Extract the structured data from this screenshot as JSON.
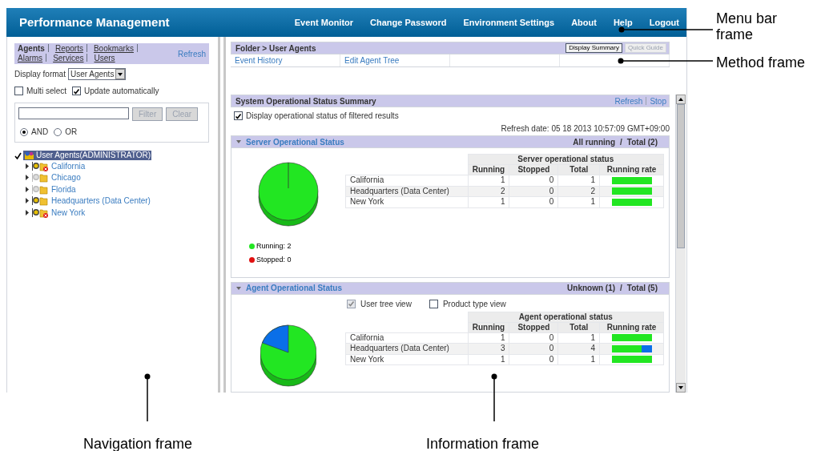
{
  "header": {
    "title": "Performance Management",
    "menu": [
      "Event Monitor",
      "Change Password",
      "Environment Settings",
      "About",
      "Help",
      "Logout"
    ]
  },
  "navigation": {
    "tabs": [
      {
        "label": "Agents",
        "selected": true
      },
      {
        "label": "Reports",
        "selected": false
      },
      {
        "label": "Bookmarks",
        "selected": false
      },
      {
        "label": "Alarms",
        "selected": false
      },
      {
        "label": "Services",
        "selected": false
      },
      {
        "label": "Users",
        "selected": false
      }
    ],
    "refresh": "Refresh",
    "display_format": {
      "label": "Display format",
      "value": "User Agents"
    },
    "options": [
      {
        "label": "Multi select",
        "checked": false
      },
      {
        "label": "Update automatically",
        "checked": true
      }
    ],
    "filter": {
      "buttons": [
        {
          "label": "Filter",
          "disabled": true
        },
        {
          "label": "Clear",
          "disabled": true
        }
      ],
      "conditions": [
        {
          "label": "AND",
          "selected": true
        },
        {
          "label": "OR",
          "selected": false
        }
      ]
    },
    "tree": {
      "label": "User Agents(ADMINISTRATOR)",
      "selected": true,
      "children": [
        {
          "label": "California",
          "kind": "error"
        },
        {
          "label": "Chicago",
          "kind": "inactive"
        },
        {
          "label": "Florida",
          "kind": "inactive"
        },
        {
          "label": "Headquarters (Data Center)",
          "kind": "normal"
        },
        {
          "label": "New York",
          "kind": "error"
        }
      ]
    }
  },
  "method": {
    "breadcrumb": "Folder > User Agents",
    "buttons": [
      {
        "label": "Display Summary",
        "disabled": false
      },
      {
        "label": "Quick Guide",
        "disabled": true
      }
    ],
    "links": [
      "Event History",
      "Edit Agent Tree"
    ]
  },
  "summary": {
    "title": "System Operational Status Summary",
    "actions": [
      "Refresh",
      "Stop"
    ],
    "filter_option": {
      "label": "Display operational status of filtered results",
      "checked": true
    },
    "refresh_date": "Refresh date: 05 18 2013 10:57:09 GMT+09:00",
    "sections": [
      {
        "title": "Server Operational Status",
        "status": [
          "All running",
          "/",
          "Total (2)"
        ],
        "legend": [
          {
            "label": "Running: 2",
            "color": "#22e622"
          },
          {
            "label": "Stopped: 0",
            "color": "#e01010"
          }
        ],
        "table": {
          "group": "Server operational status",
          "columns": [
            "Running",
            "Stopped",
            "Total",
            "Running rate"
          ],
          "rows": [
            {
              "name": "California",
              "values": [
                "1",
                "0",
                "1"
              ],
              "level": 1
            },
            {
              "name": "Headquarters (Data Center)",
              "values": [
                "2",
                "0",
                "2"
              ],
              "level": 1
            },
            {
              "name": "New York",
              "values": [
                "1",
                "0",
                "1"
              ],
              "level": 1
            }
          ]
        }
      },
      {
        "title": "Agent Operational Status",
        "status": [
          "Unknown (1)",
          "/",
          "Total (5)"
        ],
        "views": [
          {
            "label": "User tree view",
            "checked": true,
            "disabled": true
          },
          {
            "label": "Product type view",
            "checked": false,
            "disabled": false
          }
        ],
        "table": {
          "group": "Agent operational status",
          "columns": [
            "Running",
            "Stopped",
            "Total",
            "Running rate"
          ],
          "rows": [
            {
              "name": "California",
              "values": [
                "1",
                "0",
                "1"
              ],
              "level": 1
            },
            {
              "name": "Headquarters (Data Center)",
              "values": [
                "3",
                "0",
                "4"
              ],
              "level": 0.75
            },
            {
              "name": "New York",
              "values": [
                "1",
                "0",
                "1"
              ],
              "level": 1
            }
          ]
        }
      }
    ]
  },
  "callouts": [
    "Menu bar frame",
    "Method frame",
    "Navigation frame",
    "Information frame"
  ]
}
